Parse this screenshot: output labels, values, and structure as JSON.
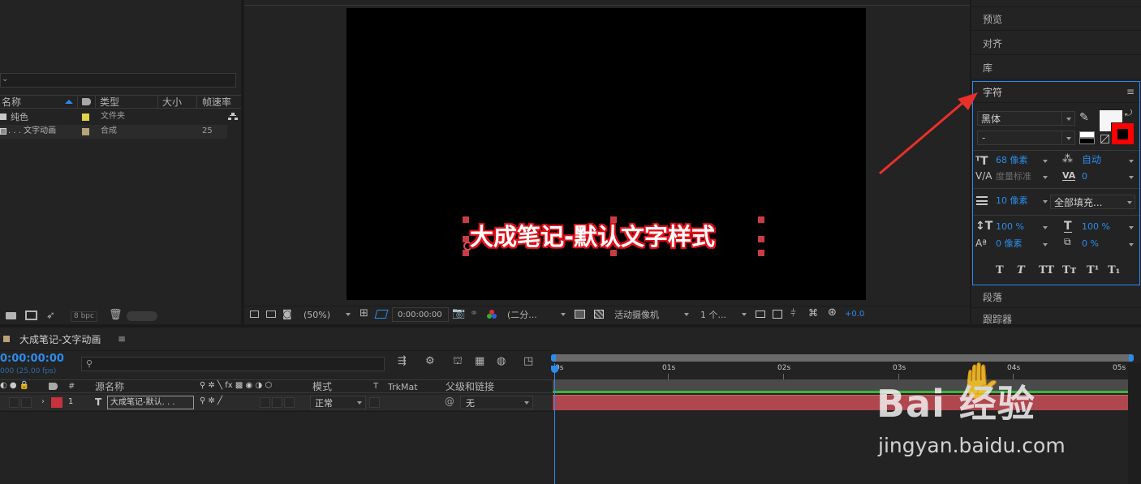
{
  "project": {
    "col_name": "名称",
    "col_type": "类型",
    "col_size": "大小",
    "col_fps": "帧速率",
    "items": [
      {
        "name": "纯色",
        "type": "文件夹",
        "fps": "",
        "color": "#e1d24a"
      },
      {
        "name": ". . . 文字动画",
        "type": "合成",
        "fps": "25",
        "color": "#b8a27a"
      }
    ],
    "bpc": "8 bpc"
  },
  "viewer": {
    "text": "大成笔记-默认文字样式",
    "zoom": "(50%)",
    "timecode": "0:00:00:00",
    "resolution": "(二分...",
    "camera": "活动摄像机",
    "views": "1 个...",
    "exposure": "+0.0"
  },
  "right_panels": {
    "preview": "预览",
    "align": "对齐",
    "library": "库",
    "character": "字符",
    "paragraph": "段落",
    "tracker": "跟踪器"
  },
  "character": {
    "font": "黑体",
    "style": "-",
    "font_size": "68 像素",
    "leading": "自动",
    "kerning": "度量标准",
    "tracking": "0",
    "stroke_width": "10 像素",
    "stroke_mode": "全部填充...",
    "vscale": "100 %",
    "hscale": "100 %",
    "baseline": "0 像素",
    "tsume": "0 %",
    "fill_color": "#f5f5f5",
    "stroke_color": "#ff0000",
    "style_buttons": [
      "T",
      "T",
      "TT",
      "Tт",
      "T¹",
      "T₁"
    ]
  },
  "timeline": {
    "comp_name": "大成笔记-文字动画",
    "timecode": "0:00:00:00",
    "fps_info": "000 (25.00 fps)",
    "col_num": "#",
    "col_source": "源名称",
    "col_mode": "模式",
    "col_t": "T",
    "col_trkmat": "TrkMat",
    "col_parent": "父级和链接",
    "layer": {
      "index": "1",
      "type_icon": "T",
      "name": "大成笔记-默认. . .",
      "mode": "正常",
      "parent": "无",
      "label_color": "#c8323c"
    },
    "ruler": [
      "0s",
      "01s",
      "02s",
      "03s",
      "04s",
      "05s"
    ]
  },
  "watermark": {
    "brand": "Bai 经验",
    "url": "jingyan.baidu.com"
  }
}
